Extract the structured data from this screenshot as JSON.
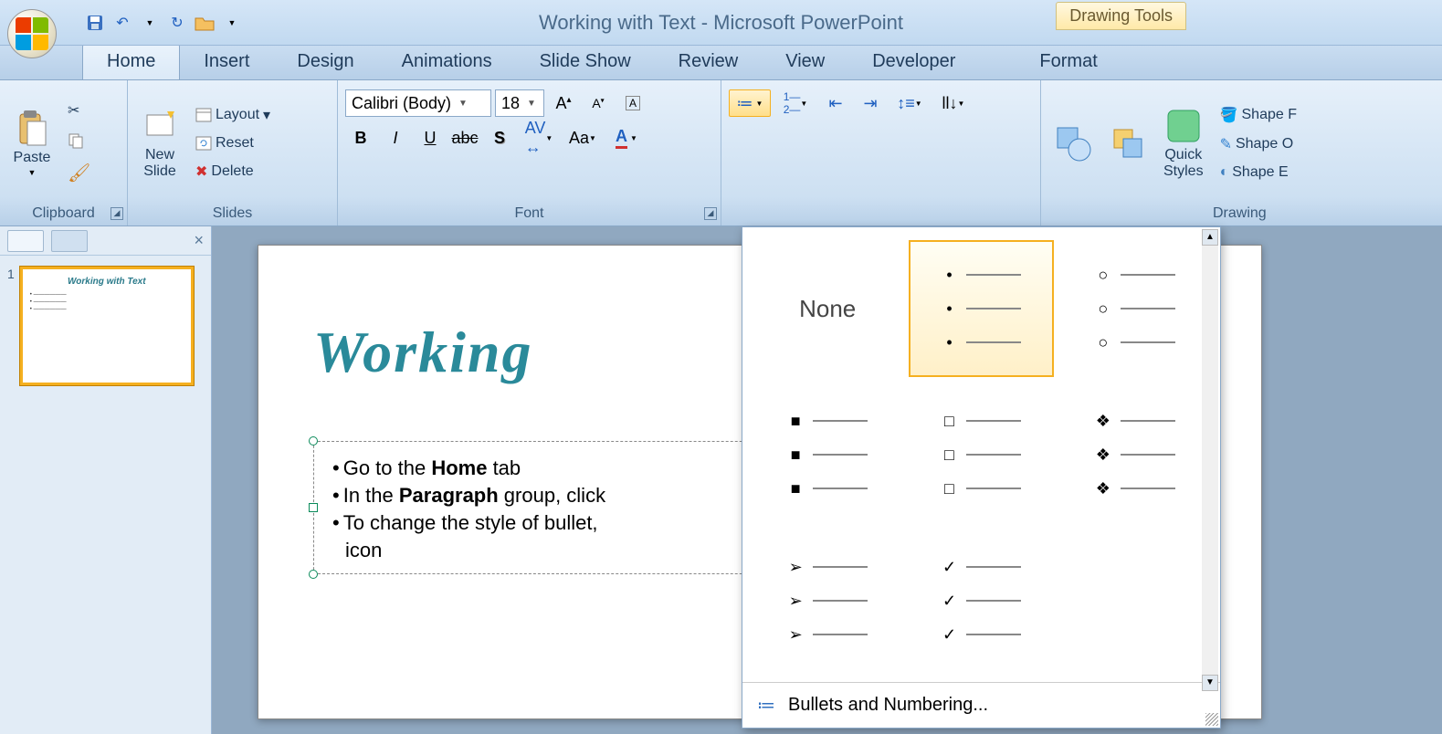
{
  "title": "Working with Text - Microsoft PowerPoint",
  "contextTab": "Drawing Tools",
  "tabs": [
    "Home",
    "Insert",
    "Design",
    "Animations",
    "Slide Show",
    "Review",
    "View",
    "Developer",
    "Format"
  ],
  "activeTab": "Home",
  "groups": {
    "clipboard": "Clipboard",
    "slides": "Slides",
    "font": "Font",
    "drawing": "Drawing"
  },
  "clipboard": {
    "paste": "Paste"
  },
  "slidesGroup": {
    "newSlide": "New\nSlide",
    "layout": "Layout",
    "reset": "Reset",
    "delete": "Delete"
  },
  "font": {
    "name": "Calibri (Body)",
    "size": "18"
  },
  "drawing": {
    "quickStyles": "Quick\nStyles",
    "shapeFill": "Shape F",
    "shapeOutline": "Shape O",
    "shapeEffects": "Shape E"
  },
  "slide": {
    "number": "1",
    "title": "Working",
    "bullets": [
      {
        "pre": "Go to the ",
        "bold": "Home",
        "post": " tab"
      },
      {
        "pre": "In the ",
        "bold": "Paragraph",
        "post": " group, click"
      },
      {
        "pre": "To change the style of bullet,",
        "bold": "",
        "post": ""
      }
    ],
    "lastLine": "icon"
  },
  "thumb": {
    "title": "Working with Text"
  },
  "bulletsMenu": {
    "none": "None",
    "footer": "Bullets and Numbering...",
    "options": [
      "none",
      "disc",
      "circle",
      "square",
      "hollow-square",
      "diamond4",
      "arrow",
      "check"
    ]
  }
}
